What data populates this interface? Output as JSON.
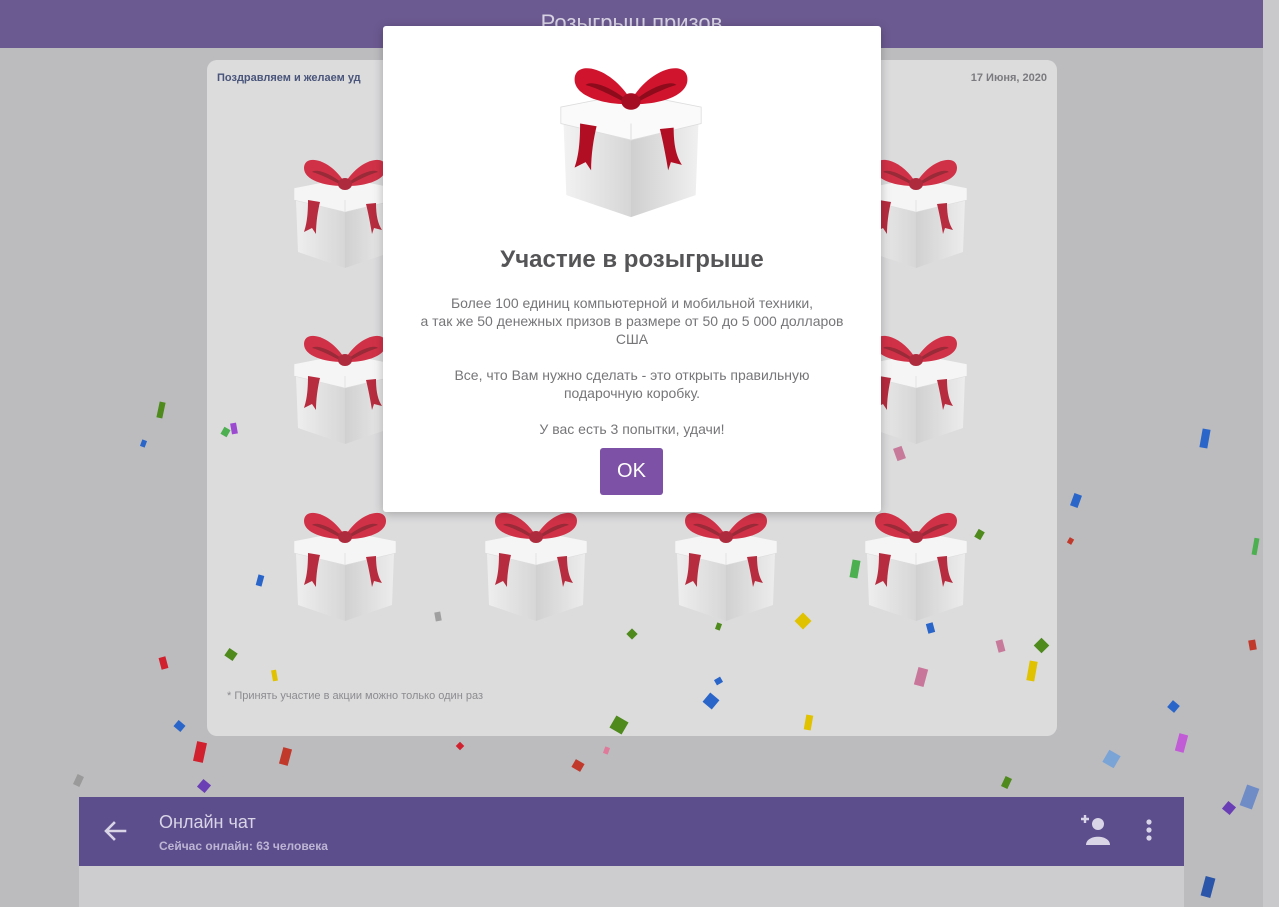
{
  "page": {
    "title": "Розыгрыш призов"
  },
  "panel": {
    "congrats": "Поздравляем и желаем уд",
    "date": "17 Июня, 2020",
    "note": "* Принять участие в акции можно только один раз"
  },
  "modal": {
    "title": "Участие в розыгрыше",
    "text_lines": [
      "Более 100 единиц компьютерной и мобильной техники,",
      "а так же 50 денежных призов в размере от 50 до 5 000 долларов",
      "США"
    ],
    "text_2_lines": [
      "Все, что Вам нужно сделать - это открыть правильную",
      "подарочную коробку."
    ],
    "text_3": "У вас есть 3 попытки, удачи!",
    "ok_label": "OK"
  },
  "chat": {
    "title": "Онлайн чат",
    "online_label": "Сейчас онлайн:",
    "online_count": "63 человека",
    "icons": {
      "back": "arrow-left-icon",
      "add_user": "add-user-icon",
      "more": "more-vert-icon"
    }
  },
  "colors": {
    "brand": "#7d51a5",
    "header": "#6b5a91",
    "chat_bar": "#5c4e8d",
    "ribbon": "#c8102e"
  }
}
